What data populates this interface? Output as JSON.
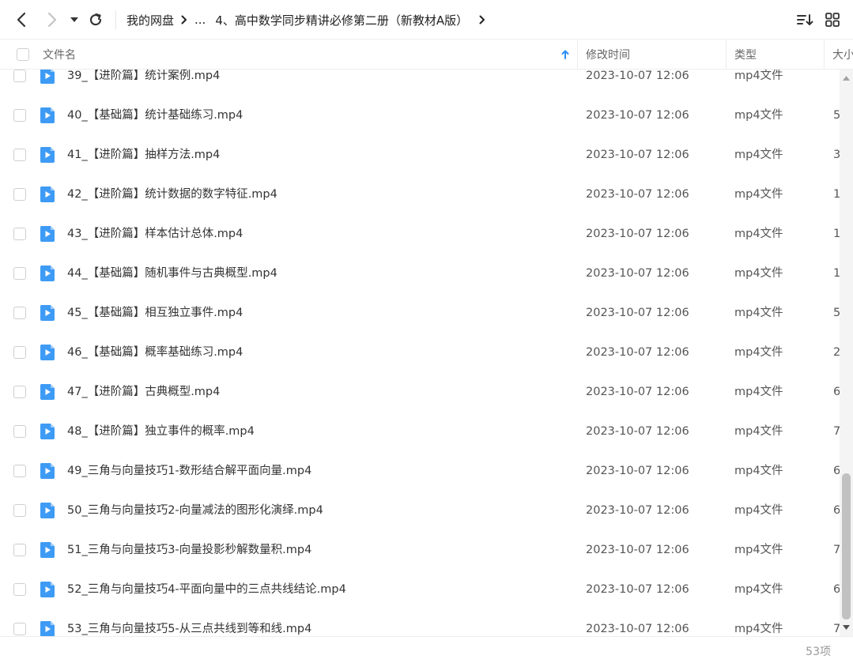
{
  "toolbar": {
    "icons": [
      "back-arrow-icon",
      "forward-arrow-icon",
      "dropdown-caret-icon",
      "refresh-icon",
      "sort-icon",
      "grid-view-icon"
    ],
    "breadcrumb": [
      "我的网盘",
      "...",
      "4、高中数学同步精讲必修第二册（新教材A版）"
    ]
  },
  "columns": {
    "name": "文件名",
    "modified": "修改时间",
    "type": "类型",
    "size": "大小"
  },
  "files": [
    {
      "name": "39_【进阶篇】统计案例.mp4",
      "modified": "2023-10-07 12:06",
      "type": "mp4文件",
      "size": ""
    },
    {
      "name": "40_【基础篇】统计基础练习.mp4",
      "modified": "2023-10-07 12:06",
      "type": "mp4文件",
      "size": "5"
    },
    {
      "name": "41_【进阶篇】抽样方法.mp4",
      "modified": "2023-10-07 12:06",
      "type": "mp4文件",
      "size": "3"
    },
    {
      "name": "42_【进阶篇】统计数据的数字特征.mp4",
      "modified": "2023-10-07 12:06",
      "type": "mp4文件",
      "size": "1"
    },
    {
      "name": "43_【进阶篇】样本估计总体.mp4",
      "modified": "2023-10-07 12:06",
      "type": "mp4文件",
      "size": "1"
    },
    {
      "name": "44_【基础篇】随机事件与古典概型.mp4",
      "modified": "2023-10-07 12:06",
      "type": "mp4文件",
      "size": "1"
    },
    {
      "name": "45_【基础篇】相互独立事件.mp4",
      "modified": "2023-10-07 12:06",
      "type": "mp4文件",
      "size": "5"
    },
    {
      "name": "46_【基础篇】概率基础练习.mp4",
      "modified": "2023-10-07 12:06",
      "type": "mp4文件",
      "size": "2"
    },
    {
      "name": "47_【进阶篇】古典概型.mp4",
      "modified": "2023-10-07 12:06",
      "type": "mp4文件",
      "size": "6"
    },
    {
      "name": "48_【进阶篇】独立事件的概率.mp4",
      "modified": "2023-10-07 12:06",
      "type": "mp4文件",
      "size": "7"
    },
    {
      "name": "49_三角与向量技巧1-数形结合解平面向量.mp4",
      "modified": "2023-10-07 12:06",
      "type": "mp4文件",
      "size": "6"
    },
    {
      "name": "50_三角与向量技巧2-向量减法的图形化演绎.mp4",
      "modified": "2023-10-07 12:06",
      "type": "mp4文件",
      "size": "6"
    },
    {
      "name": "51_三角与向量技巧3-向量投影秒解数量积.mp4",
      "modified": "2023-10-07 12:06",
      "type": "mp4文件",
      "size": "7"
    },
    {
      "name": "52_三角与向量技巧4-平面向量中的三点共线结论.mp4",
      "modified": "2023-10-07 12:06",
      "type": "mp4文件",
      "size": "6"
    },
    {
      "name": "53_三角与向量技巧5-从三点共线到等和线.mp4",
      "modified": "2023-10-07 12:06",
      "type": "mp4文件",
      "size": "7"
    }
  ],
  "footer": {
    "count": "53项"
  },
  "colors": {
    "accent": "#2b8ff5",
    "file_icon": "#3e9bf5",
    "text": "#333333",
    "muted": "#999999"
  }
}
